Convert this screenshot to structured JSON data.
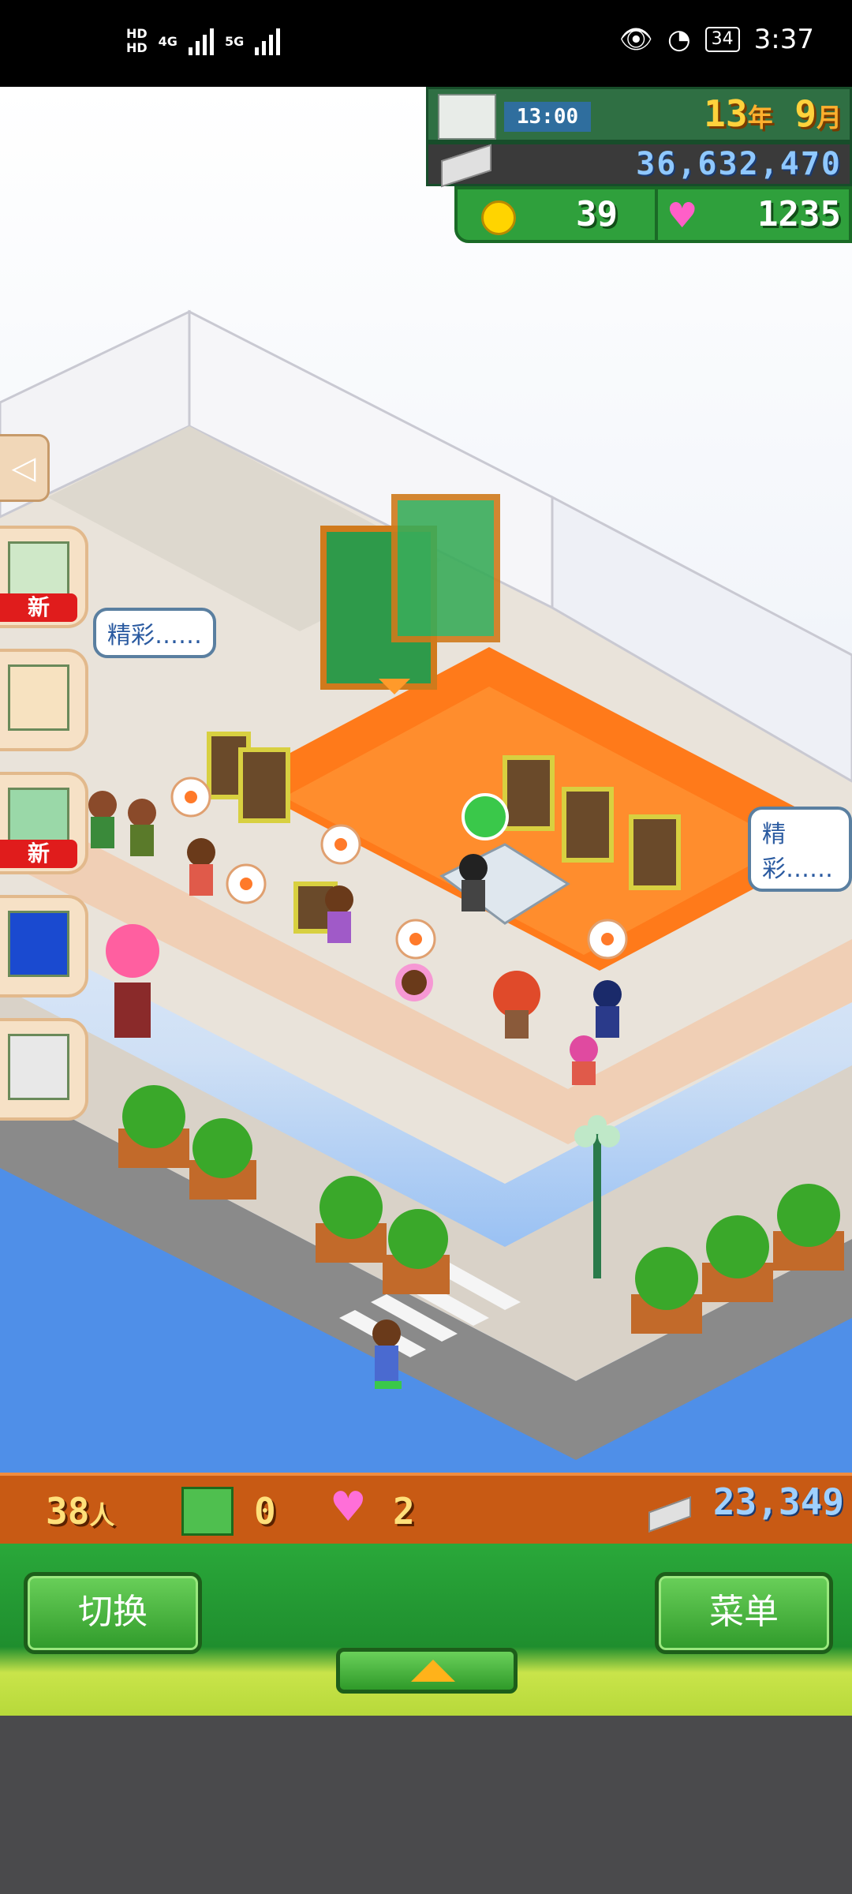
{
  "status_bar": {
    "hd1": "HD",
    "hd2": "HD",
    "net1": "4G",
    "net2": "5G",
    "battery": "34",
    "time": "3:37"
  },
  "hud": {
    "time": "13:00",
    "year": "13",
    "year_unit": "年",
    "month": "9",
    "month_unit": "月",
    "money": "36,632,470",
    "coins": "39",
    "hearts": "1235"
  },
  "side_menu": {
    "collapse_icon": "chevron-left-icon",
    "new_badge_1": "新",
    "new_badge_2": "新"
  },
  "speech": {
    "bubble_left": "精彩……",
    "bubble_right": "精彩……"
  },
  "info_bar": {
    "visitors": "38",
    "visitors_unit": "人",
    "gifts": "0",
    "likes": "2",
    "income": "23,349"
  },
  "controls": {
    "switch_label": "切换",
    "menu_label": "菜单"
  }
}
